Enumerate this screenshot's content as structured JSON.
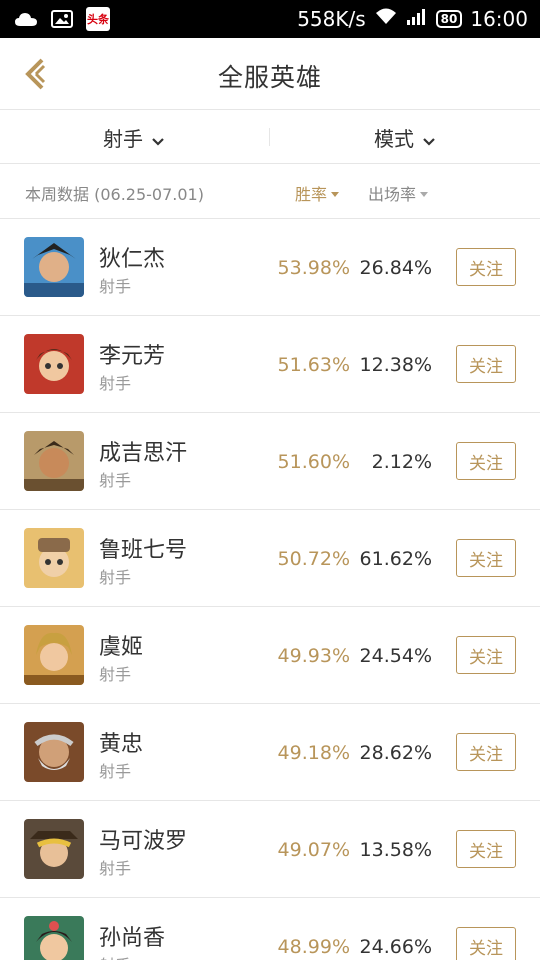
{
  "status_bar": {
    "news_badge": "头条",
    "net_speed": "558K/s",
    "battery": "80",
    "time": "16:00"
  },
  "header": {
    "title": "全服英雄",
    "back_icon": "back-chevron-icon"
  },
  "filters": {
    "role": "射手",
    "mode": "模式"
  },
  "stats_header": {
    "week_label": "本周数据 (06.25-07.01)",
    "win_rate_label": "胜率",
    "pick_rate_label": "出场率"
  },
  "colors": {
    "accent": "#b8955a",
    "text": "#333333",
    "muted": "#999999",
    "divider": "#e6e6e6"
  },
  "heroes": [
    {
      "name": "狄仁杰",
      "role": "射手",
      "win_rate": "53.98%",
      "pick_rate": "26.84%",
      "follow": "关注"
    },
    {
      "name": "李元芳",
      "role": "射手",
      "win_rate": "51.63%",
      "pick_rate": "12.38%",
      "follow": "关注"
    },
    {
      "name": "成吉思汗",
      "role": "射手",
      "win_rate": "51.60%",
      "pick_rate": "2.12%",
      "follow": "关注"
    },
    {
      "name": "鲁班七号",
      "role": "射手",
      "win_rate": "50.72%",
      "pick_rate": "61.62%",
      "follow": "关注"
    },
    {
      "name": "虞姬",
      "role": "射手",
      "win_rate": "49.93%",
      "pick_rate": "24.54%",
      "follow": "关注"
    },
    {
      "name": "黄忠",
      "role": "射手",
      "win_rate": "49.18%",
      "pick_rate": "28.62%",
      "follow": "关注"
    },
    {
      "name": "马可波罗",
      "role": "射手",
      "win_rate": "49.07%",
      "pick_rate": "13.58%",
      "follow": "关注"
    },
    {
      "name": "孙尚香",
      "role": "射手",
      "win_rate": "48.99%",
      "pick_rate": "24.66%",
      "follow": "关注"
    }
  ]
}
